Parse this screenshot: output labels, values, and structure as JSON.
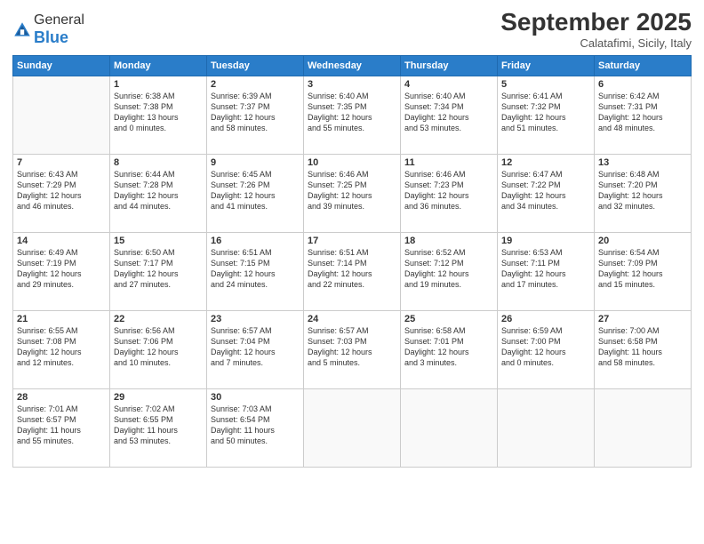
{
  "logo": {
    "general": "General",
    "blue": "Blue"
  },
  "header": {
    "month": "September 2025",
    "location": "Calatafimi, Sicily, Italy"
  },
  "weekdays": [
    "Sunday",
    "Monday",
    "Tuesday",
    "Wednesday",
    "Thursday",
    "Friday",
    "Saturday"
  ],
  "weeks": [
    [
      {
        "day": "",
        "content": ""
      },
      {
        "day": "1",
        "content": "Sunrise: 6:38 AM\nSunset: 7:38 PM\nDaylight: 13 hours\nand 0 minutes."
      },
      {
        "day": "2",
        "content": "Sunrise: 6:39 AM\nSunset: 7:37 PM\nDaylight: 12 hours\nand 58 minutes."
      },
      {
        "day": "3",
        "content": "Sunrise: 6:40 AM\nSunset: 7:35 PM\nDaylight: 12 hours\nand 55 minutes."
      },
      {
        "day": "4",
        "content": "Sunrise: 6:40 AM\nSunset: 7:34 PM\nDaylight: 12 hours\nand 53 minutes."
      },
      {
        "day": "5",
        "content": "Sunrise: 6:41 AM\nSunset: 7:32 PM\nDaylight: 12 hours\nand 51 minutes."
      },
      {
        "day": "6",
        "content": "Sunrise: 6:42 AM\nSunset: 7:31 PM\nDaylight: 12 hours\nand 48 minutes."
      }
    ],
    [
      {
        "day": "7",
        "content": "Sunrise: 6:43 AM\nSunset: 7:29 PM\nDaylight: 12 hours\nand 46 minutes."
      },
      {
        "day": "8",
        "content": "Sunrise: 6:44 AM\nSunset: 7:28 PM\nDaylight: 12 hours\nand 44 minutes."
      },
      {
        "day": "9",
        "content": "Sunrise: 6:45 AM\nSunset: 7:26 PM\nDaylight: 12 hours\nand 41 minutes."
      },
      {
        "day": "10",
        "content": "Sunrise: 6:46 AM\nSunset: 7:25 PM\nDaylight: 12 hours\nand 39 minutes."
      },
      {
        "day": "11",
        "content": "Sunrise: 6:46 AM\nSunset: 7:23 PM\nDaylight: 12 hours\nand 36 minutes."
      },
      {
        "day": "12",
        "content": "Sunrise: 6:47 AM\nSunset: 7:22 PM\nDaylight: 12 hours\nand 34 minutes."
      },
      {
        "day": "13",
        "content": "Sunrise: 6:48 AM\nSunset: 7:20 PM\nDaylight: 12 hours\nand 32 minutes."
      }
    ],
    [
      {
        "day": "14",
        "content": "Sunrise: 6:49 AM\nSunset: 7:19 PM\nDaylight: 12 hours\nand 29 minutes."
      },
      {
        "day": "15",
        "content": "Sunrise: 6:50 AM\nSunset: 7:17 PM\nDaylight: 12 hours\nand 27 minutes."
      },
      {
        "day": "16",
        "content": "Sunrise: 6:51 AM\nSunset: 7:15 PM\nDaylight: 12 hours\nand 24 minutes."
      },
      {
        "day": "17",
        "content": "Sunrise: 6:51 AM\nSunset: 7:14 PM\nDaylight: 12 hours\nand 22 minutes."
      },
      {
        "day": "18",
        "content": "Sunrise: 6:52 AM\nSunset: 7:12 PM\nDaylight: 12 hours\nand 19 minutes."
      },
      {
        "day": "19",
        "content": "Sunrise: 6:53 AM\nSunset: 7:11 PM\nDaylight: 12 hours\nand 17 minutes."
      },
      {
        "day": "20",
        "content": "Sunrise: 6:54 AM\nSunset: 7:09 PM\nDaylight: 12 hours\nand 15 minutes."
      }
    ],
    [
      {
        "day": "21",
        "content": "Sunrise: 6:55 AM\nSunset: 7:08 PM\nDaylight: 12 hours\nand 12 minutes."
      },
      {
        "day": "22",
        "content": "Sunrise: 6:56 AM\nSunset: 7:06 PM\nDaylight: 12 hours\nand 10 minutes."
      },
      {
        "day": "23",
        "content": "Sunrise: 6:57 AM\nSunset: 7:04 PM\nDaylight: 12 hours\nand 7 minutes."
      },
      {
        "day": "24",
        "content": "Sunrise: 6:57 AM\nSunset: 7:03 PM\nDaylight: 12 hours\nand 5 minutes."
      },
      {
        "day": "25",
        "content": "Sunrise: 6:58 AM\nSunset: 7:01 PM\nDaylight: 12 hours\nand 3 minutes."
      },
      {
        "day": "26",
        "content": "Sunrise: 6:59 AM\nSunset: 7:00 PM\nDaylight: 12 hours\nand 0 minutes."
      },
      {
        "day": "27",
        "content": "Sunrise: 7:00 AM\nSunset: 6:58 PM\nDaylight: 11 hours\nand 58 minutes."
      }
    ],
    [
      {
        "day": "28",
        "content": "Sunrise: 7:01 AM\nSunset: 6:57 PM\nDaylight: 11 hours\nand 55 minutes."
      },
      {
        "day": "29",
        "content": "Sunrise: 7:02 AM\nSunset: 6:55 PM\nDaylight: 11 hours\nand 53 minutes."
      },
      {
        "day": "30",
        "content": "Sunrise: 7:03 AM\nSunset: 6:54 PM\nDaylight: 11 hours\nand 50 minutes."
      },
      {
        "day": "",
        "content": ""
      },
      {
        "day": "",
        "content": ""
      },
      {
        "day": "",
        "content": ""
      },
      {
        "day": "",
        "content": ""
      }
    ]
  ]
}
